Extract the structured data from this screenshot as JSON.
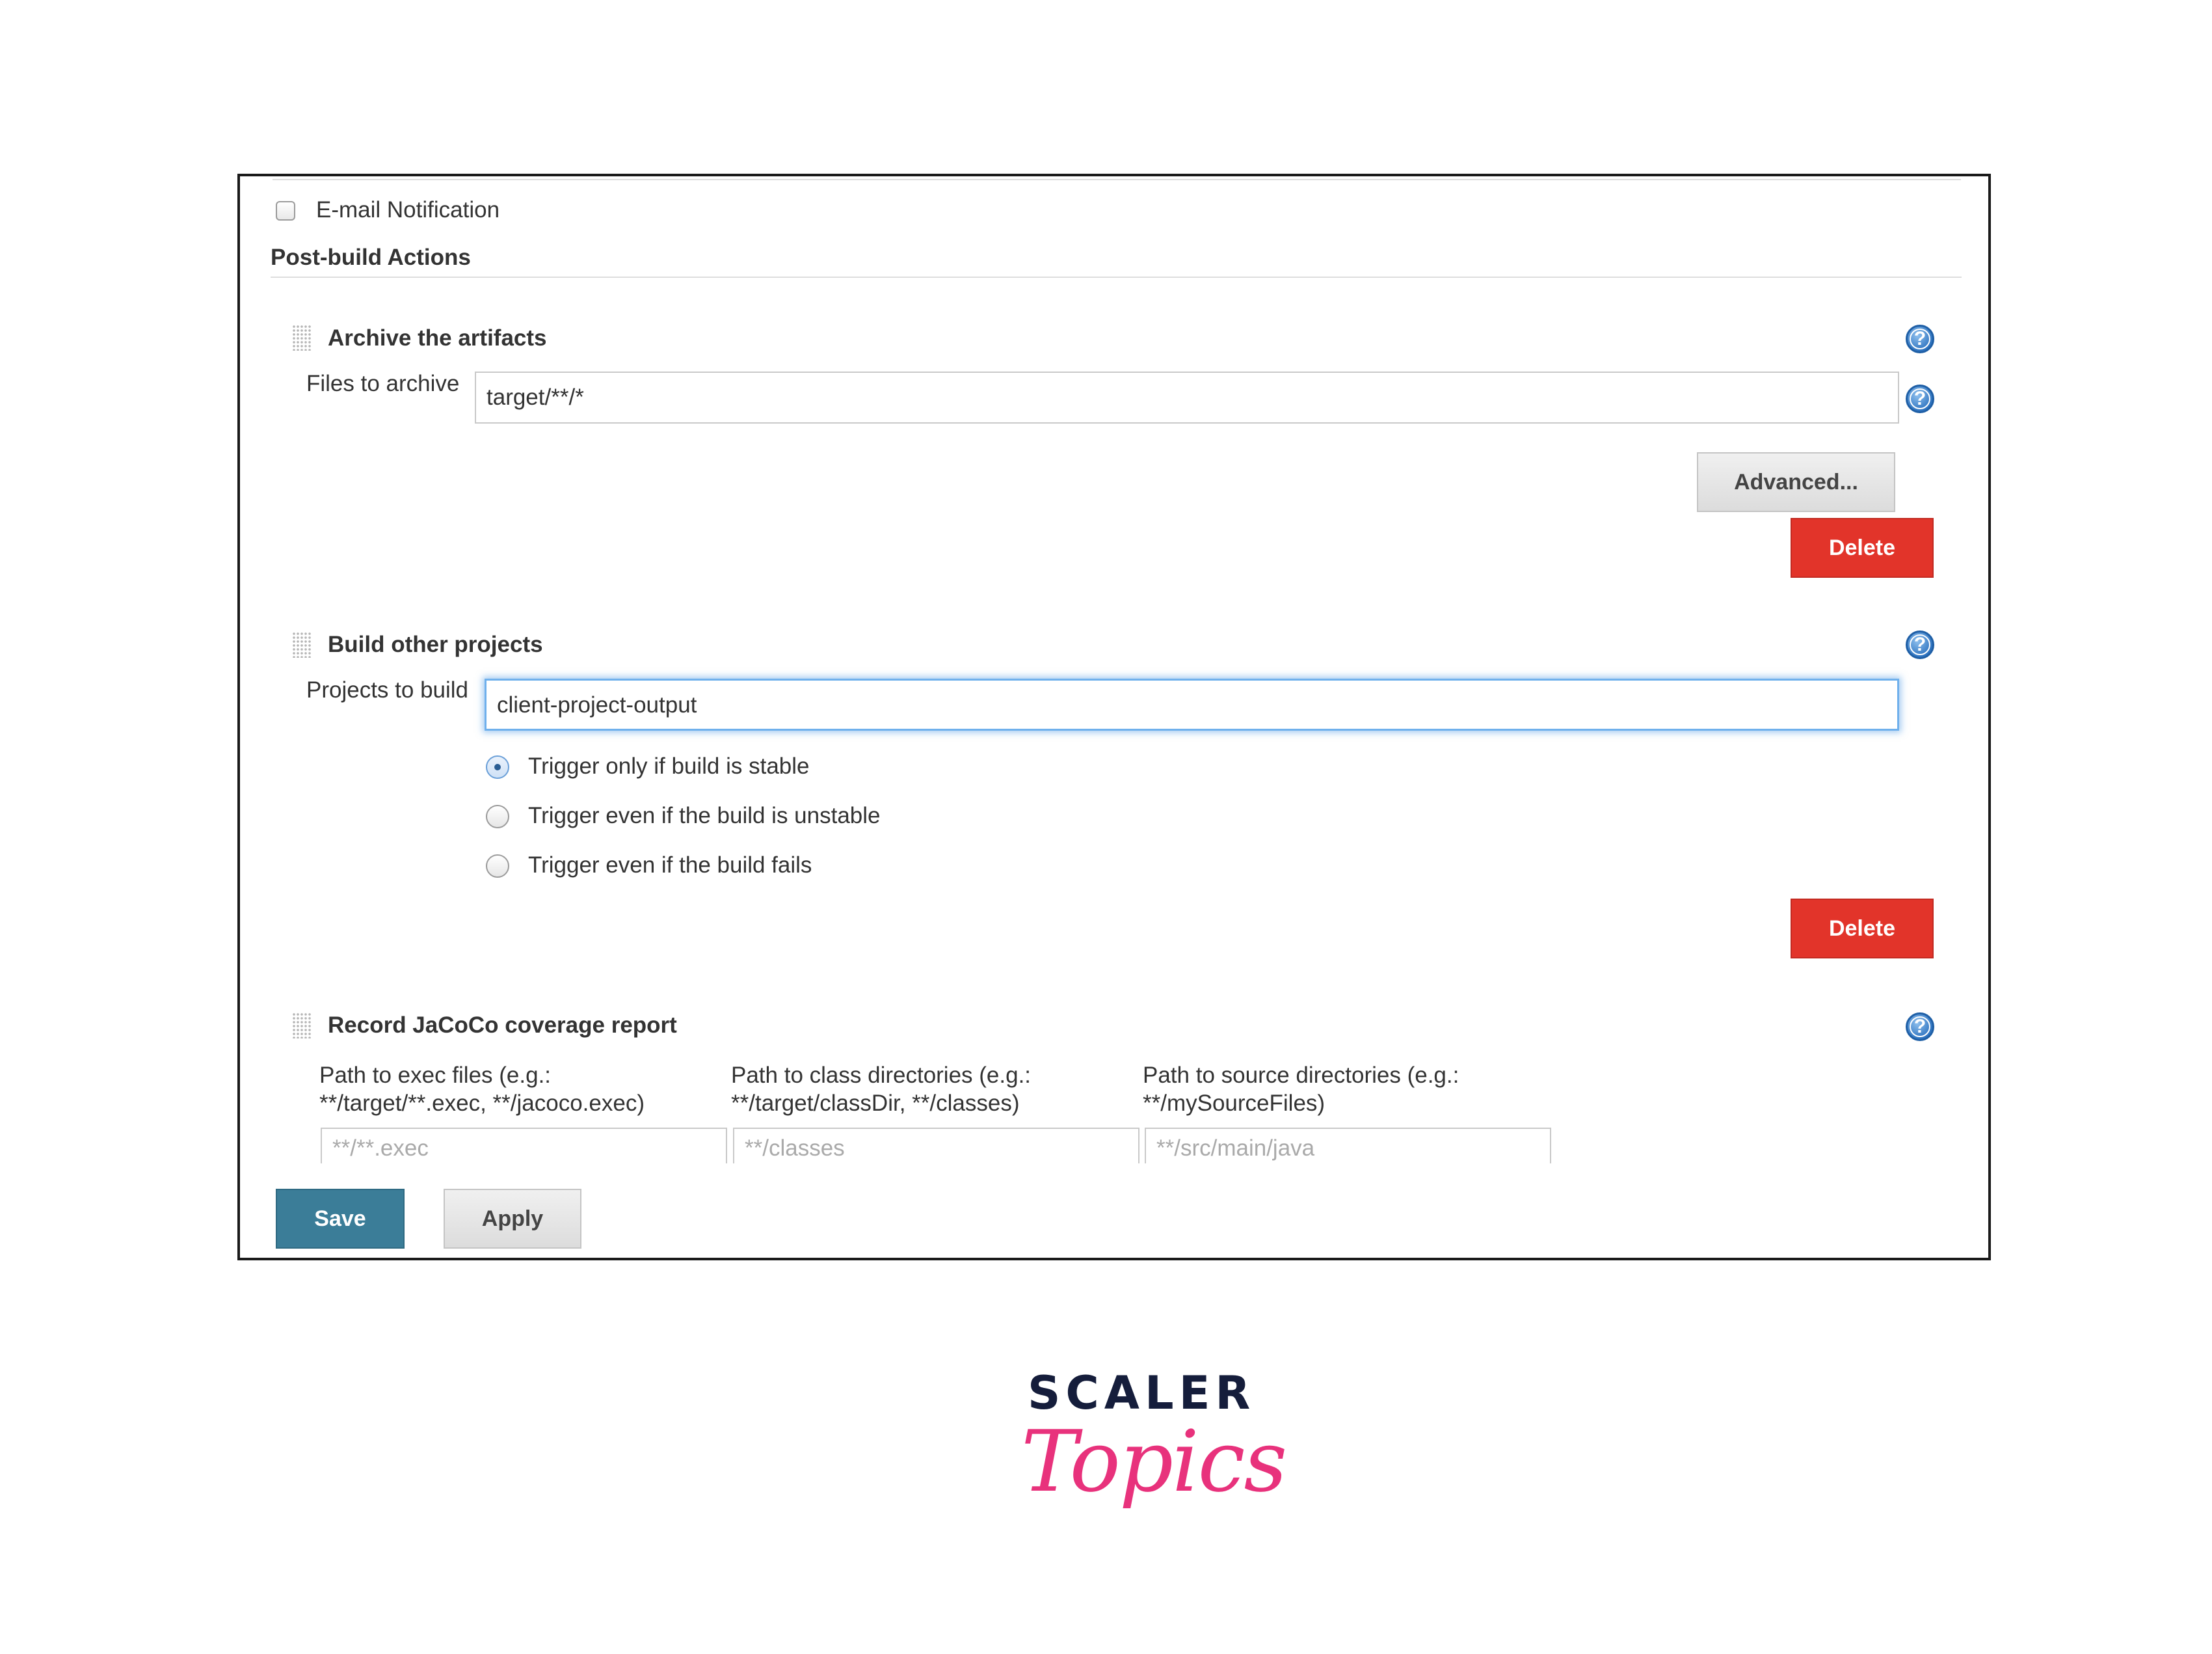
{
  "email_notification": {
    "label": "E-mail Notification",
    "checked": false
  },
  "post_build": {
    "heading": "Post-build Actions"
  },
  "archive": {
    "title": "Archive the artifacts",
    "field_label": "Files to archive",
    "field_value": "target/**/*",
    "advanced_label": "Advanced...",
    "delete_label": "Delete"
  },
  "build_other": {
    "title": "Build other projects",
    "field_label": "Projects to build",
    "field_value": "client-project-output",
    "options": [
      {
        "label": "Trigger only if build is stable",
        "selected": true
      },
      {
        "label": "Trigger even if the build is unstable",
        "selected": false
      },
      {
        "label": "Trigger even if the build fails",
        "selected": false
      }
    ],
    "delete_label": "Delete"
  },
  "jacoco": {
    "title": "Record JaCoCo coverage report",
    "columns": [
      {
        "line1": "Path to exec files (e.g.:",
        "line2": "**/target/**.exec, **/jacoco.exec)",
        "placeholder": "**/**.exec"
      },
      {
        "line1": "Path to class directories (e.g.:",
        "line2": "**/target/classDir, **/classes)",
        "placeholder": "**/classes"
      },
      {
        "line1": "Path to source directories (e.g.:",
        "line2": "**/mySourceFiles)",
        "placeholder": "**/src/main/java"
      }
    ]
  },
  "footer": {
    "save_label": "Save",
    "apply_label": "Apply"
  },
  "help_icon_glyph": "?",
  "brand": {
    "line1": "SCALER",
    "line2": "Topics"
  },
  "colors": {
    "delete": "#e2342a",
    "save": "#3b7d98",
    "help": "#2f74c0",
    "focus": "#6fb0ec",
    "brand_dark": "#151d3b",
    "brand_pink": "#e8327c"
  }
}
